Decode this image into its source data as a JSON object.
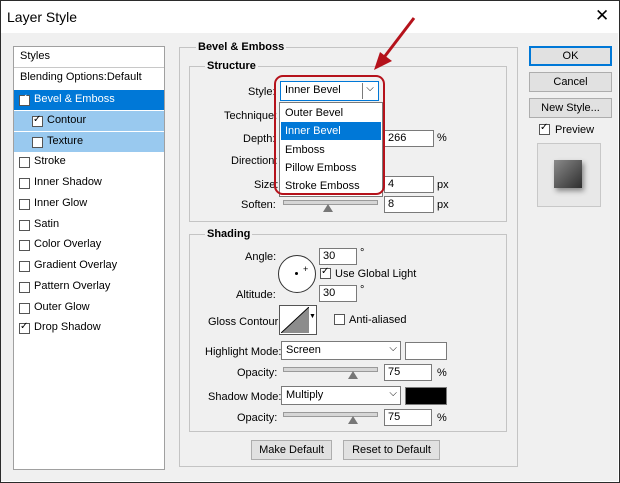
{
  "window": {
    "title": "Layer Style"
  },
  "styles_panel": {
    "header": "Styles",
    "blending": "Blending Options:Default",
    "items": [
      {
        "label": "Bevel & Emboss",
        "checked": true
      },
      {
        "label": "Contour",
        "checked": true
      },
      {
        "label": "Texture",
        "checked": false
      },
      {
        "label": "Stroke",
        "checked": false
      },
      {
        "label": "Inner Shadow",
        "checked": false
      },
      {
        "label": "Inner Glow",
        "checked": false
      },
      {
        "label": "Satin",
        "checked": false
      },
      {
        "label": "Color Overlay",
        "checked": false
      },
      {
        "label": "Gradient Overlay",
        "checked": false
      },
      {
        "label": "Pattern Overlay",
        "checked": false
      },
      {
        "label": "Outer Glow",
        "checked": false
      },
      {
        "label": "Drop Shadow",
        "checked": true
      }
    ]
  },
  "bevel": {
    "section_title": "Bevel & Emboss",
    "structure_title": "Structure",
    "style_label": "Style:",
    "style_value": "Inner Bevel",
    "technique_label": "Technique:",
    "depth_label": "Depth:",
    "depth_value": "266",
    "depth_unit": "%",
    "direction_label": "Direction:",
    "size_label": "Size:",
    "size_value": "4",
    "size_unit": "px",
    "soften_label": "Soften:",
    "soften_value": "8",
    "soften_unit": "px",
    "style_options": [
      "Outer Bevel",
      "Inner Bevel",
      "Emboss",
      "Pillow Emboss",
      "Stroke Emboss"
    ]
  },
  "shading": {
    "title": "Shading",
    "angle_label": "Angle:",
    "angle_value": "30",
    "angle_unit": "°",
    "global_light_label": "Use Global Light",
    "altitude_label": "Altitude:",
    "altitude_value": "30",
    "altitude_unit": "°",
    "gloss_contour_label": "Gloss Contour:",
    "anti_aliased_label": "Anti-aliased",
    "highlight_mode_label": "Highlight Mode:",
    "highlight_mode_value": "Screen",
    "highlight_opacity_label": "Opacity:",
    "highlight_opacity_value": "75",
    "highlight_opacity_unit": "%",
    "shadow_mode_label": "Shadow Mode:",
    "shadow_mode_value": "Multiply",
    "shadow_opacity_label": "Opacity:",
    "shadow_opacity_value": "75",
    "shadow_opacity_unit": "%",
    "highlight_color": "#ffffff",
    "shadow_color": "#000000"
  },
  "buttons": {
    "make_default": "Make Default",
    "reset_default": "Reset to Default",
    "ok": "OK",
    "cancel": "Cancel",
    "new_style": "New Style...",
    "preview_label": "Preview"
  },
  "colors": {
    "accent": "#0078d7",
    "selection_light": "#99c9ef",
    "annotation_red": "#b5121b"
  }
}
